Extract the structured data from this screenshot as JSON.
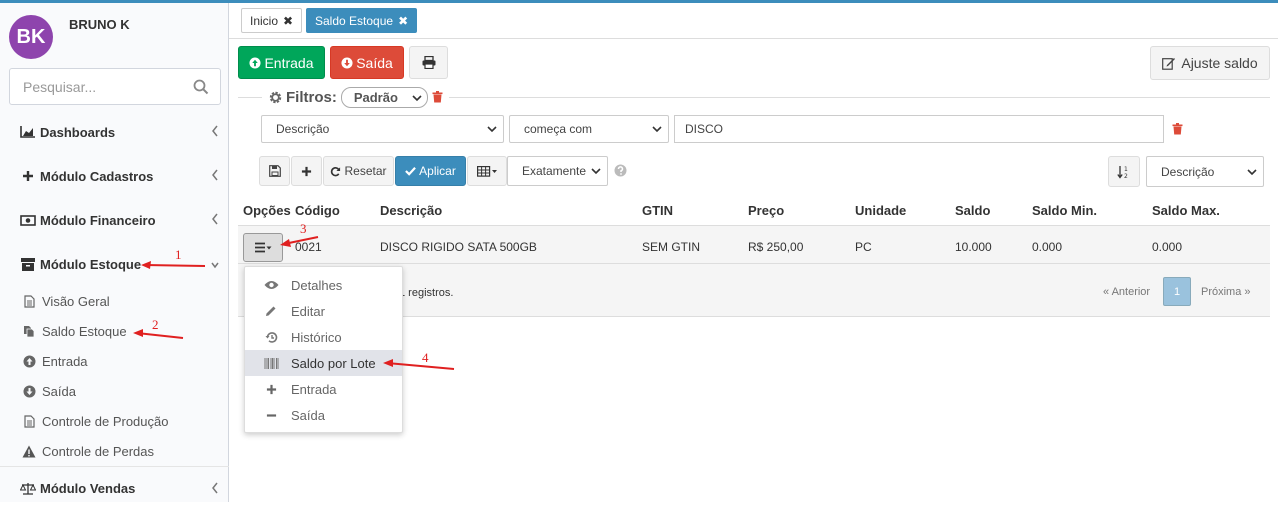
{
  "user": {
    "initials": "BK",
    "name": "BRUNO K",
    "avatar_color": "#8e44ad"
  },
  "search": {
    "placeholder": "Pesquisar..."
  },
  "sidebar": {
    "menu": [
      {
        "label": "Dashboards",
        "icon": "area-chart-icon"
      },
      {
        "label": "Módulo Cadastros",
        "icon": "plus-icon"
      },
      {
        "label": "Módulo Financeiro",
        "icon": "money-icon"
      },
      {
        "label": "Módulo Estoque",
        "icon": "archive-icon"
      },
      {
        "label": "Módulo Vendas",
        "icon": "balance-scale-icon"
      }
    ],
    "sub_items": [
      {
        "label": "Visão Geral",
        "icon": "file-icon"
      },
      {
        "label": "Saldo Estoque",
        "icon": "files-icon"
      },
      {
        "label": "Entrada",
        "icon": "arrow-circle-up-icon"
      },
      {
        "label": "Saída",
        "icon": "arrow-circle-down-icon"
      },
      {
        "label": "Controle de Produção",
        "icon": "file-icon"
      },
      {
        "label": "Controle de Perdas",
        "icon": "warning-icon"
      }
    ]
  },
  "tabs": [
    {
      "label": "Inicio",
      "active": false
    },
    {
      "label": "Saldo Estoque",
      "active": true
    }
  ],
  "toolbar": {
    "entrada_label": "Entrada",
    "saida_label": "Saída",
    "ajuste_label": "Ajuste saldo"
  },
  "filters": {
    "title": "Filtros:",
    "preset": "Padrão",
    "field": "Descrição",
    "operator": "começa com",
    "value": "DISCO",
    "reset_label": "Resetar",
    "apply_label": "Aplicar",
    "match_mode": "Exatamente",
    "sort_field": "Descrição"
  },
  "table": {
    "headers": [
      "Opções",
      "Código",
      "Descrição",
      "GTIN",
      "Preço",
      "Unidade",
      "Saldo",
      "Saldo Min.",
      "Saldo Max."
    ],
    "rows": [
      [
        "0021",
        "DISCO RIGIDO SATA 500GB",
        "SEM GTIN",
        "R$ 250,00",
        "PC",
        "10.000",
        "0.000",
        "0.000"
      ]
    ],
    "footer_text": "1 registros.",
    "pagination": {
      "prev": "« Anterior",
      "page": "1",
      "next": "Próxima »"
    }
  },
  "options_menu": [
    {
      "label": "Detalhes",
      "icon": "eye-icon"
    },
    {
      "label": "Editar",
      "icon": "pencil-icon"
    },
    {
      "label": "Histórico",
      "icon": "history-icon"
    },
    {
      "label": "Saldo por Lote",
      "icon": "barcode-icon"
    },
    {
      "label": "Entrada",
      "icon": "plus-icon"
    },
    {
      "label": "Saída",
      "icon": "minus-icon"
    }
  ],
  "annotations": [
    "1",
    "2",
    "3",
    "4"
  ]
}
